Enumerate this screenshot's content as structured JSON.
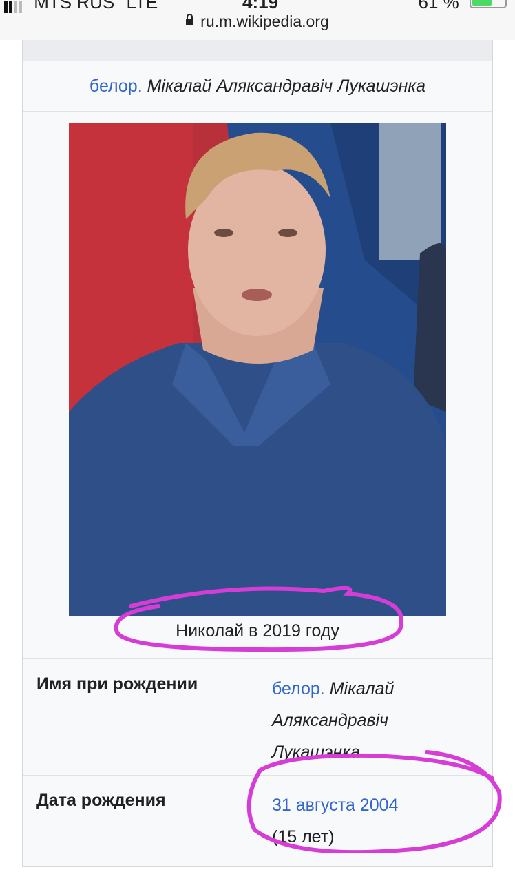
{
  "status_bar": {
    "carrier": "MTS RUS",
    "network": "LTE",
    "time": "4:19",
    "battery_percent": "61 %",
    "battery_level": 0.61
  },
  "browser": {
    "url": "ru.m.wikipedia.org"
  },
  "infobox": {
    "original_name": {
      "lang": "белор.",
      "name": "Мікалай Аляксандравіч Лукашэнка"
    },
    "photo": {
      "caption": "Николай в 2019 году",
      "icon": "portrait-photo"
    },
    "rows": [
      {
        "label": "Имя при рождении",
        "lang": "белор.",
        "value_lines": [
          "Мікалай",
          "Аляксандравіч",
          "Лукашэнка"
        ]
      },
      {
        "label": "Дата рождения",
        "date_link": "31 августа 2004",
        "age": "(15 лет)"
      }
    ]
  },
  "annotations": {
    "color": "#d63dd6"
  },
  "colors": {
    "link": "#3366cc",
    "text": "#202122",
    "infobox_bg": "#f8f9fa"
  }
}
